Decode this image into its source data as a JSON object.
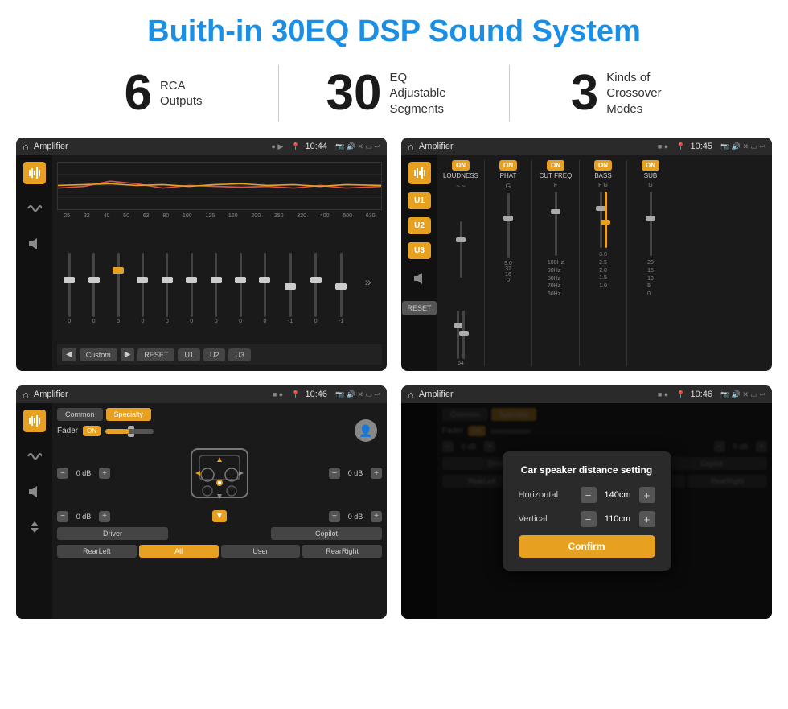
{
  "page": {
    "title": "Buith-in 30EQ DSP Sound System"
  },
  "stats": [
    {
      "number": "6",
      "desc_line1": "RCA",
      "desc_line2": "Outputs"
    },
    {
      "number": "30",
      "desc_line1": "EQ Adjustable",
      "desc_line2": "Segments"
    },
    {
      "number": "3",
      "desc_line1": "Kinds of",
      "desc_line2": "Crossover Modes"
    }
  ],
  "screens": [
    {
      "id": "screen1",
      "title": "Amplifier",
      "time": "10:44",
      "type": "eq",
      "freq_labels": [
        "25",
        "32",
        "40",
        "50",
        "63",
        "80",
        "100",
        "125",
        "160",
        "200",
        "250",
        "320",
        "400",
        "500",
        "630"
      ],
      "slider_values": [
        "0",
        "0",
        "0",
        "5",
        "0",
        "0",
        "0",
        "0",
        "0",
        "0",
        "-1",
        "0",
        "-1"
      ],
      "bottom_buttons": [
        "Custom",
        "RESET",
        "U1",
        "U2",
        "U3"
      ]
    },
    {
      "id": "screen2",
      "title": "Amplifier",
      "time": "10:45",
      "type": "crossover",
      "u_buttons": [
        "U1",
        "U2",
        "U3"
      ],
      "columns": [
        {
          "on": true,
          "label": "LOUDNESS",
          "values": [
            "~",
            "~"
          ]
        },
        {
          "on": true,
          "label": "PHAT",
          "values": [
            "G",
            ""
          ]
        },
        {
          "on": true,
          "label": "CUT FREQ",
          "values": [
            "F",
            ""
          ]
        },
        {
          "on": true,
          "label": "BASS",
          "values": [
            "F",
            "G"
          ]
        },
        {
          "on": true,
          "label": "SUB",
          "values": [
            "G",
            ""
          ]
        }
      ]
    },
    {
      "id": "screen3",
      "title": "Amplifier",
      "time": "10:46",
      "type": "fader",
      "tabs": [
        "Common",
        "Specialty"
      ],
      "fader_label": "Fader",
      "fader_on": "ON",
      "db_values": [
        "0 dB",
        "0 dB",
        "0 dB",
        "0 dB"
      ],
      "bottom_buttons": [
        "Driver",
        "Copilot",
        "RearLeft",
        "All",
        "User",
        "RearRight"
      ]
    },
    {
      "id": "screen4",
      "title": "Amplifier",
      "time": "10:46",
      "type": "distance_dialog",
      "tabs": [
        "Common",
        "Specialty"
      ],
      "dialog": {
        "title": "Car speaker distance setting",
        "horizontal_label": "Horizontal",
        "horizontal_value": "140cm",
        "vertical_label": "Vertical",
        "vertical_value": "110cm",
        "confirm_label": "Confirm"
      },
      "db_values": [
        "0 dB",
        "0 dB"
      ],
      "bottom_buttons": [
        "Driver",
        "Copilot",
        "RearLeft",
        "All",
        "User",
        "RearRight"
      ]
    }
  ]
}
